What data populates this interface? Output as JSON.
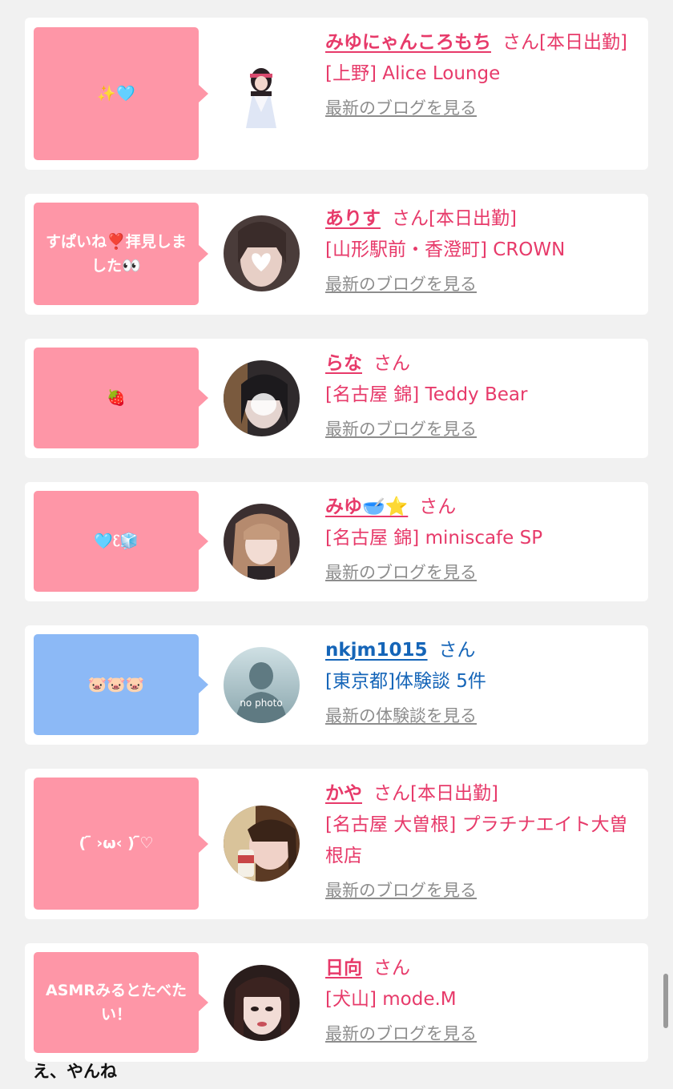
{
  "cards": [
    {
      "message": "✨🩵",
      "name": "みゆにゃんころもち",
      "san": "さん",
      "status": "[本日出勤]",
      "shop": "[上野] Alice Lounge",
      "more": "最新のブログを見る"
    },
    {
      "message": "すぱいね❣️拝見しました👀",
      "name": "ありす",
      "san": "さん",
      "status": "[本日出勤]",
      "shop": "[山形駅前・香澄町] CROWN",
      "more": "最新のブログを見る"
    },
    {
      "message": "🍓",
      "name": "らな",
      "san": "さん",
      "status": "",
      "shop": "[名古屋 錦] Teddy Bear",
      "more": "最新のブログを見る"
    },
    {
      "message": "🩵ᦷ🧊",
      "name": "みゆ🥣⭐",
      "san": "さん",
      "status": "",
      "shop": "[名古屋 錦] miniscafe SP",
      "more": "最新のブログを見る"
    },
    {
      "message": "🐷🐷🐷",
      "name": "nkjm1015",
      "san": "さん",
      "status": "",
      "shop": "[東京都]体験談 5件",
      "more": "最新の体験談を見る",
      "avatar_text": "no photo"
    },
    {
      "message": "( ᷇ ›ω‹ ) ᷇♡",
      "name": "かや",
      "san": "さん",
      "status": "[本日出勤]",
      "shop": "[名古屋 大曽根] プラチナエイト大曽根店",
      "more": "最新のブログを見る"
    },
    {
      "message": "ASMRみるとたべたい！",
      "name": "日向",
      "san": "さん",
      "status": "",
      "shop": "[犬山] mode.M",
      "more": "最新のブログを見る"
    }
  ],
  "caption": "え、やんね",
  "colors": {
    "pink": "#fe96a7",
    "blue": "#8cb9f6",
    "name_pink": "#e73a6a",
    "name_blue": "#1565b8"
  }
}
